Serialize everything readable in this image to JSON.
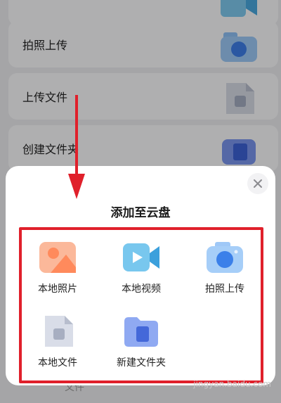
{
  "background": {
    "items": [
      {
        "label": "拍照上传"
      },
      {
        "label": "上传文件"
      },
      {
        "label": "创建文件夹"
      }
    ],
    "bottom_tab": "文件"
  },
  "sheet": {
    "title": "添加至云盘",
    "close_icon": "close-icon",
    "options": [
      {
        "label": "本地照片",
        "icon": "photo-icon"
      },
      {
        "label": "本地视频",
        "icon": "video-icon"
      },
      {
        "label": "拍照上传",
        "icon": "camera-icon"
      },
      {
        "label": "本地文件",
        "icon": "file-icon"
      },
      {
        "label": "新建文件夹",
        "icon": "folder-icon"
      }
    ]
  },
  "annotation": {
    "arrow_color": "#e0202b",
    "box_color": "#e0202b"
  },
  "watermark": "jingyan.baidu.com"
}
